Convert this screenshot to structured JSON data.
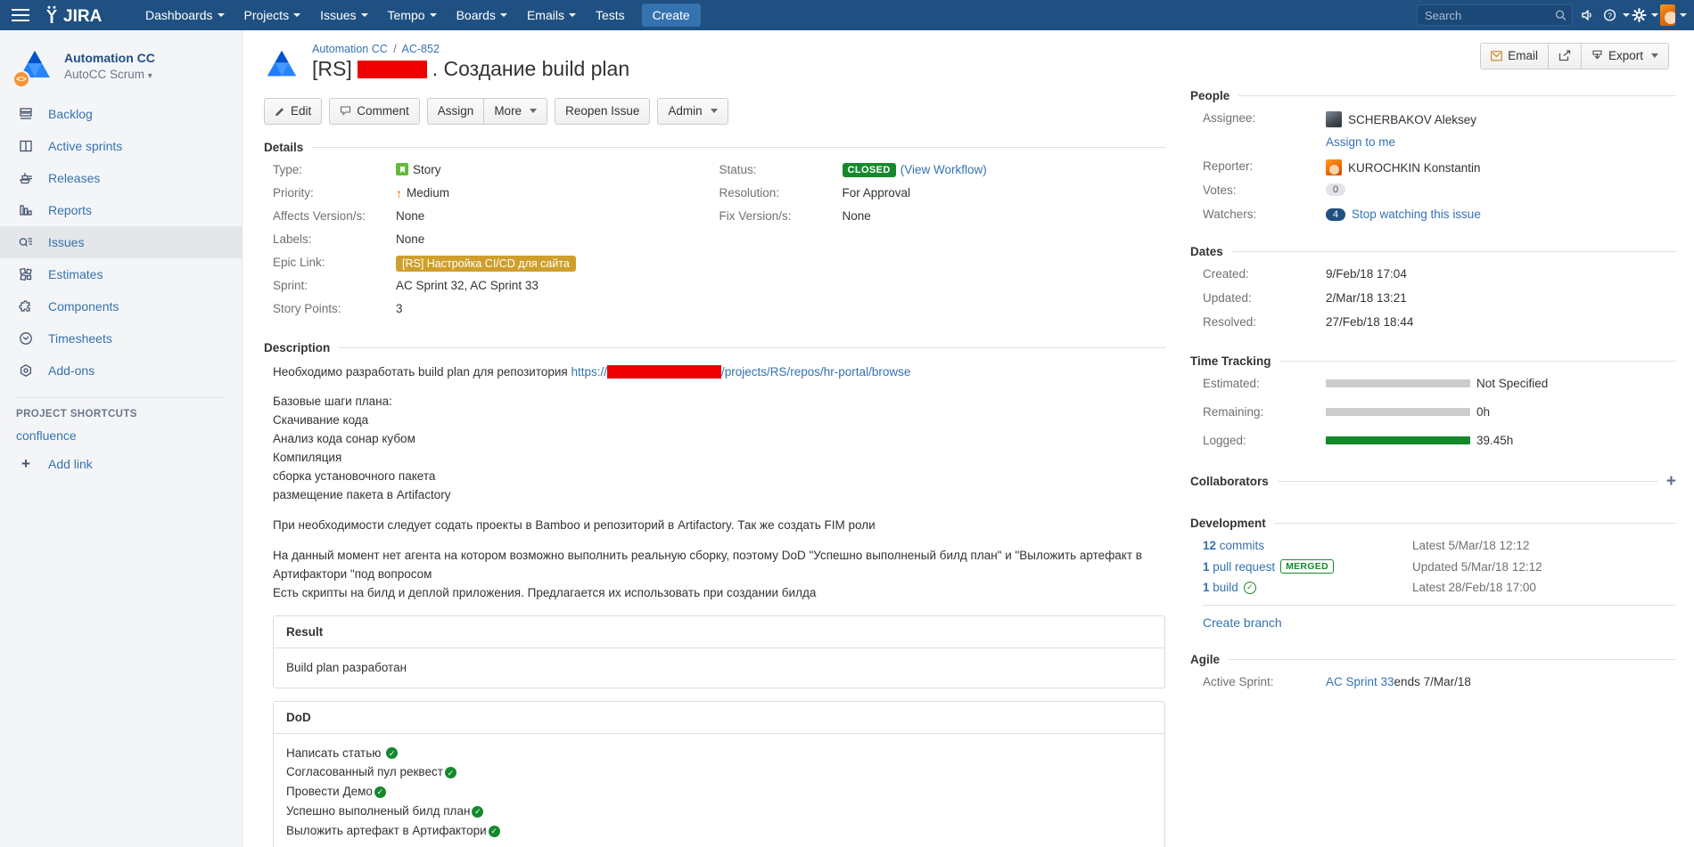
{
  "topnav": {
    "brand": "JIRA",
    "items": [
      {
        "label": "Dashboards",
        "has_caret": true
      },
      {
        "label": "Projects",
        "has_caret": true
      },
      {
        "label": "Issues",
        "has_caret": true
      },
      {
        "label": "Tempo",
        "has_caret": true
      },
      {
        "label": "Boards",
        "has_caret": true
      },
      {
        "label": "Emails",
        "has_caret": true
      },
      {
        "label": "Tests",
        "has_caret": false
      }
    ],
    "create_label": "Create",
    "search_placeholder": "Search",
    "search_value": "",
    "icons": [
      "search-icon",
      "megaphone-icon",
      "help-icon",
      "settings-icon",
      "user-avatar"
    ]
  },
  "sidebar": {
    "project_name": "Automation CC",
    "project_board": "AutoCC Scrum",
    "items": [
      {
        "label": "Backlog",
        "icon": "backlog-icon",
        "active": false
      },
      {
        "label": "Active sprints",
        "icon": "columns-icon",
        "active": false
      },
      {
        "label": "Releases",
        "icon": "ship-icon",
        "active": false
      },
      {
        "label": "Reports",
        "icon": "bar-chart-icon",
        "active": false
      },
      {
        "label": "Issues",
        "icon": "magnifier-list-icon",
        "active": true
      },
      {
        "label": "Estimates",
        "icon": "estimates-icon",
        "active": false
      },
      {
        "label": "Components",
        "icon": "puzzle-icon",
        "active": false
      },
      {
        "label": "Timesheets",
        "icon": "clock-icon",
        "active": false
      },
      {
        "label": "Add-ons",
        "icon": "hexagon-icon",
        "active": false
      }
    ],
    "shortcuts_header": "PROJECT SHORTCUTS",
    "shortcuts": [
      {
        "label": "confluence"
      }
    ],
    "add_link_label": "Add link"
  },
  "issue": {
    "breadcrumb_project": "Automation CC",
    "breadcrumb_key": "AC-852",
    "breadcrumb_separator": "/",
    "title_prefix": "[RS]",
    "title_suffix": ". Создание build plan",
    "buttons": {
      "edit": "Edit",
      "comment": "Comment",
      "assign": "Assign",
      "more": "More",
      "reopen": "Reopen Issue",
      "admin": "Admin",
      "email": "Email",
      "export": "Export"
    }
  },
  "details": {
    "header": "Details",
    "left": [
      {
        "label": "Type:",
        "value": "Story",
        "icon": "story-icon"
      },
      {
        "label": "Priority:",
        "value": "Medium",
        "icon": "priority-medium-icon"
      },
      {
        "label": "Affects Version/s:",
        "value": "None"
      },
      {
        "label": "Labels:",
        "value": "None"
      },
      {
        "label": "Epic Link:",
        "value": "[RS] Настройка CI/CD для сайта",
        "style": "epic-lozenge"
      },
      {
        "label": "Sprint:",
        "value": "AC Sprint 32, AC Sprint 33"
      },
      {
        "label": "Story Points:",
        "value": "3"
      }
    ],
    "right": [
      {
        "label": "Status:",
        "value": "CLOSED",
        "link": "(View Workflow)",
        "style": "lozenge"
      },
      {
        "label": "Resolution:",
        "value": "For Approval"
      },
      {
        "label": "Fix Version/s:",
        "value": "None"
      }
    ]
  },
  "description": {
    "header": "Description",
    "intro_before_link": "Необходимо разработать build plan для репозитория ",
    "link_prefix": "https://",
    "link_suffix": "/projects/RS/repos/hr-portal/browse",
    "steps_header": "Базовые шаги плана:",
    "steps": [
      "Скачивание кода",
      "Анализ кода сонар кубом",
      "Компиляция",
      "сборка установочного пакета",
      "размещение пакета в Artifactory"
    ],
    "para2": "При необходимости следует содать проекты в Bamboo и репозиторий в Artifactory. Так же создать FIM роли",
    "para3": "На данный момент нет агента на котором возможно выполнить реальную сборку, поэтому DoD \"Успешно выполненый билд план\" и \"Выложить артефакт в Артифактори \"под вопросом",
    "para4": "Есть скрипты на билд и деплой приложения. Предлагается их использовать при создании билда"
  },
  "result_panel": {
    "header": "Result",
    "body": "Build plan разработан"
  },
  "dod_panel": {
    "header": "DoD",
    "items": [
      "Написать статью",
      "Согласованный пул реквест",
      "Провести Демо",
      "Успешно выполненый билд план",
      "Выложить артефакт в Артифактори"
    ]
  },
  "people": {
    "header": "People",
    "assignee_label": "Assignee:",
    "assignee": "SCHERBAKOV Aleksey",
    "assign_to_me": "Assign to me",
    "reporter_label": "Reporter:",
    "reporter": "KUROCHKIN Konstantin",
    "votes_label": "Votes:",
    "votes": "0",
    "watchers_label": "Watchers:",
    "watchers": "4",
    "watch_link": "Stop watching this issue"
  },
  "dates": {
    "header": "Dates",
    "rows": [
      {
        "label": "Created:",
        "value": "9/Feb/18 17:04"
      },
      {
        "label": "Updated:",
        "value": "2/Mar/18 13:21"
      },
      {
        "label": "Resolved:",
        "value": "27/Feb/18 18:44"
      }
    ]
  },
  "time_tracking": {
    "header": "Time Tracking",
    "rows": [
      {
        "label": "Estimated:",
        "value": "Not Specified",
        "fill": "grey"
      },
      {
        "label": "Remaining:",
        "value": "0h",
        "fill": "grey"
      },
      {
        "label": "Logged:",
        "value": "39.45h",
        "fill": "green"
      }
    ]
  },
  "collaborators": {
    "header": "Collaborators",
    "add_icon": "plus-icon"
  },
  "development": {
    "header": "Development",
    "rows": [
      {
        "count": "12",
        "label": "commits",
        "badge": "",
        "right": "Latest 5/Mar/18 12:12"
      },
      {
        "count": "1",
        "label": "pull request",
        "badge": "MERGED",
        "right": "Updated 5/Mar/18 12:12"
      },
      {
        "count": "1",
        "label": "build",
        "badge": "check",
        "right": "Latest 28/Feb/18 17:00"
      }
    ],
    "create_branch": "Create branch"
  },
  "agile": {
    "header": "Agile",
    "active_sprint_label": "Active Sprint:",
    "sprint_link": "AC Sprint 33",
    "sprint_tail": " ends 7/Mar/18"
  },
  "colors": {
    "nav_blue": "#205081",
    "link_blue": "#3572b0",
    "green": "#14892c",
    "orange": "#f79232",
    "epic_gold": "#cf9f2c",
    "redaction": "#ef0000"
  }
}
